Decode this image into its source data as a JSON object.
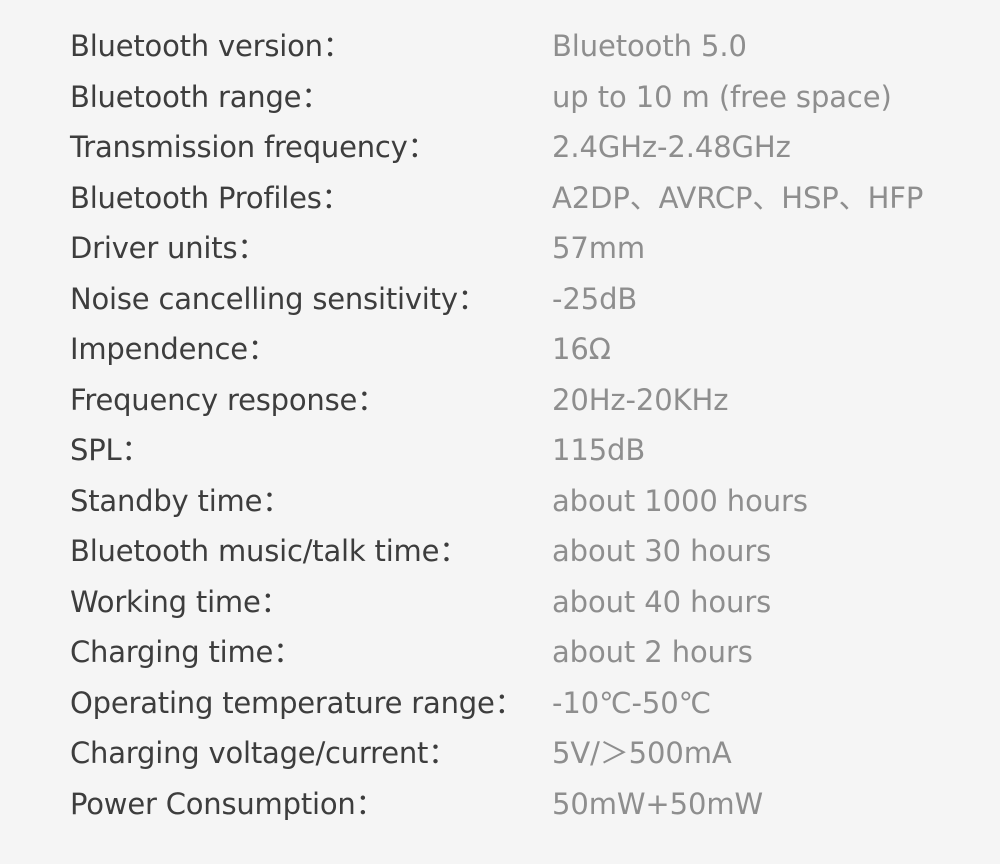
{
  "document": {
    "title": "Bluetooth headphone specifications",
    "background_color": "#f5f5f5",
    "label_color": "#3d3d3d",
    "value_color": "#8e8e8e"
  },
  "specs": [
    {
      "label": "Bluetooth version：",
      "value": "Bluetooth 5.0"
    },
    {
      "label": "Bluetooth range：",
      "value": "up to 10 m (free space)"
    },
    {
      "label": "Transmission frequency：",
      "value": "2.4GHz-2.48GHz"
    },
    {
      "label": "Bluetooth Profiles：",
      "value": "A2DP、AVRCP、HSP、HFP"
    },
    {
      "label": "Driver units：",
      "value": "57mm"
    },
    {
      "label": "Noise cancelling sensitivity：",
      "value": "-25dB"
    },
    {
      "label": "Impendence：",
      "value": "16Ω"
    },
    {
      "label": "Frequency response：",
      "value": "20Hz-20KHz"
    },
    {
      "label": "SPL：",
      "value": "115dB"
    },
    {
      "label": "Standby time：",
      "value": "about 1000 hours"
    },
    {
      "label": "Bluetooth music/talk time：",
      "value": "about 30 hours"
    },
    {
      "label": "Working time：",
      "value": "about 40 hours"
    },
    {
      "label": "Charging time：",
      "value": "about 2 hours"
    },
    {
      "label": "Operating temperature range：",
      "value": "-10℃-50℃"
    },
    {
      "label": "Charging voltage/current：",
      "value": "5V/＞500mA"
    },
    {
      "label": "Power Consumption：",
      "value": "50mW+50mW"
    }
  ]
}
